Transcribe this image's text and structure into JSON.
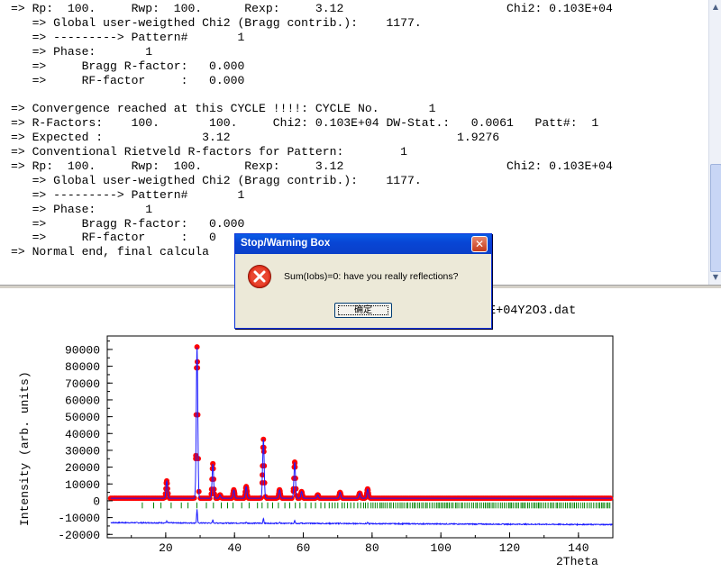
{
  "console": {
    "lines": [
      "=> Rp:  100.     Rwp:  100.      Rexp:     3.12                       Chi2: 0.103E+04",
      "   => Global user-weigthed Chi2 (Bragg contrib.):    1177.",
      "   => ---------> Pattern#       1",
      "   => Phase:       1",
      "   =>     Bragg R-factor:   0.000",
      "   =>     RF-factor     :   0.000",
      "",
      "=> Convergence reached at this CYCLE !!!!: CYCLE No.       1",
      "=> R-Factors:    100.       100.     Chi2: 0.103E+04 DW-Stat.:   0.0061   Patt#:  1",
      "=> Expected :              3.12                                1.9276",
      "=> Conventional Rietveld R-factors for Pattern:        1",
      "=> Rp:  100.     Rwp:  100.      Rexp:     3.12                       Chi2: 0.103E+04",
      "   => Global user-weigthed Chi2 (Bragg contrib.):    1177.",
      "   => ---------> Pattern#       1",
      "   => Phase:       1",
      "   =>     Bragg R-factor:   0.000",
      "   =>     RF-factor     :   0",
      "=> Normal end, final calcula"
    ]
  },
  "scrollbar": {
    "up_icon": "▲",
    "down_icon": "▼"
  },
  "dialog": {
    "title": "Stop/Warning Box",
    "close_glyph": "✕",
    "icon": "error-icon",
    "message": "Sum(Iobs)=0: have you really reflections?",
    "ok_label": "确定"
  },
  "plot": {
    "title_fragment": "E+04Y2O3.dat",
    "colors": {
      "observed": "#ff0000",
      "calculated": "#1a1aff",
      "difference": "#1a1aff",
      "bragg": "#008000"
    }
  },
  "chart_data": {
    "type": "scatter",
    "xlabel": "2Theta",
    "ylabel": "Intensity (arb. units)",
    "xlim": [
      3,
      150
    ],
    "ylim": [
      -22000,
      98000
    ],
    "xticks": [
      20,
      40,
      60,
      80,
      100,
      120,
      140
    ],
    "yticks": [
      90000,
      80000,
      70000,
      60000,
      50000,
      40000,
      30000,
      20000,
      10000,
      0,
      -10000,
      -20000
    ],
    "baseline_observed": 1500,
    "difference_offset": -13000,
    "peaks": [
      {
        "x": 20.3,
        "y": 11800
      },
      {
        "x": 29.1,
        "y": 91500
      },
      {
        "x": 33.7,
        "y": 22000
      },
      {
        "x": 35.8,
        "y": 3500
      },
      {
        "x": 39.8,
        "y": 6500
      },
      {
        "x": 43.4,
        "y": 8500
      },
      {
        "x": 48.4,
        "y": 36500
      },
      {
        "x": 53.1,
        "y": 6500
      },
      {
        "x": 57.5,
        "y": 23000
      },
      {
        "x": 59.5,
        "y": 5500
      },
      {
        "x": 64.2,
        "y": 3500
      },
      {
        "x": 70.7,
        "y": 5000
      },
      {
        "x": 76.4,
        "y": 4500
      },
      {
        "x": 78.7,
        "y": 7000
      }
    ]
  }
}
